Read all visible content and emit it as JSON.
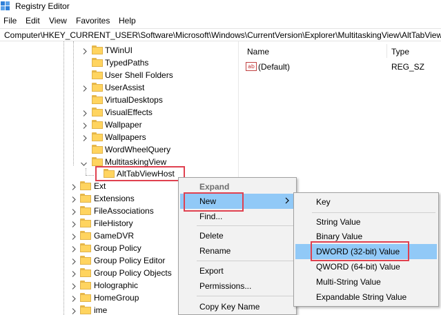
{
  "window": {
    "title": "Registry Editor"
  },
  "menu": [
    "File",
    "Edit",
    "View",
    "Favorites",
    "Help"
  ],
  "address": "Computer\\HKEY_CURRENT_USER\\Software\\Microsoft\\Windows\\CurrentVersion\\Explorer\\MultitaskingView\\AltTabViewHost",
  "tree": {
    "explorer_children": [
      {
        "label": "TWinUI",
        "expandable": true
      },
      {
        "label": "TypedPaths",
        "expandable": false
      },
      {
        "label": "User Shell Folders",
        "expandable": false
      },
      {
        "label": "UserAssist",
        "expandable": true
      },
      {
        "label": "VirtualDesktops",
        "expandable": false
      },
      {
        "label": "VisualEffects",
        "expandable": true
      },
      {
        "label": "Wallpaper",
        "expandable": true
      },
      {
        "label": "Wallpapers",
        "expandable": true
      },
      {
        "label": "WordWheelQuery",
        "expandable": false
      },
      {
        "label": "MultitaskingView",
        "expandable": true,
        "expanded": true
      }
    ],
    "selected": "AltTabViewHost",
    "cv_children": [
      {
        "label": "Ext",
        "expandable": true
      },
      {
        "label": "Extensions",
        "expandable": true
      },
      {
        "label": "FileAssociations",
        "expandable": true
      },
      {
        "label": "FileHistory",
        "expandable": true
      },
      {
        "label": "GameDVR",
        "expandable": true
      },
      {
        "label": "Group Policy",
        "expandable": true
      },
      {
        "label": "Group Policy Editor",
        "expandable": true
      },
      {
        "label": "Group Policy Objects",
        "expandable": true
      },
      {
        "label": "Holographic",
        "expandable": true
      },
      {
        "label": "HomeGroup",
        "expandable": true
      },
      {
        "label": "ime",
        "expandable": true
      }
    ]
  },
  "values_pane": {
    "headers": {
      "name": "Name",
      "type": "Type"
    },
    "rows": [
      {
        "name": "(Default)",
        "type": "REG_SZ",
        "icon": "string-value-icon"
      }
    ]
  },
  "context_menu": {
    "expand": "Expand",
    "new": "New",
    "find": "Find...",
    "delete": "Delete",
    "rename": "Rename",
    "export": "Export",
    "permissions": "Permissions...",
    "copy_key_name": "Copy Key Name"
  },
  "new_submenu": {
    "key": "Key",
    "string_value": "String Value",
    "binary_value": "Binary Value",
    "dword": "DWORD (32-bit) Value",
    "qword": "QWORD (64-bit) Value",
    "multi_string": "Multi-String Value",
    "expandable_string": "Expandable String Value"
  },
  "colors": {
    "highlight_box": "#e0404f",
    "menu_hover": "#91c9f7",
    "folder": "#ffd45f"
  }
}
